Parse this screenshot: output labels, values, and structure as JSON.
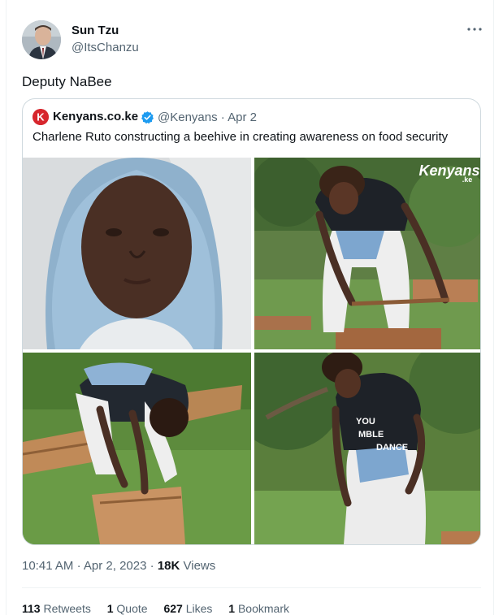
{
  "author": {
    "name": "Sun Tzu",
    "handle": "@ItsChanzu"
  },
  "tweet": {
    "text": "Deputy NaBee"
  },
  "quoted": {
    "name": "Kenyans.co.ke",
    "handle": "@Kenyans",
    "separator": "·",
    "date": "Apr 2",
    "text": "Charlene Ruto constructing a beehive in creating awareness on food security",
    "logo_letter": "K",
    "watermark": "Kenyans",
    "watermark_sub": ".ke",
    "shirt_text_1": "YOU",
    "shirt_text_2": "MBLE",
    "shirt_text_3": "DANCE"
  },
  "meta": {
    "time": "10:41 AM",
    "date": "Apr 2, 2023",
    "views_count": "18K",
    "views_label": "Views"
  },
  "stats": {
    "retweets_count": "113",
    "retweets_label": "Retweets",
    "quotes_count": "1",
    "quotes_label": "Quote",
    "likes_count": "627",
    "likes_label": "Likes",
    "bookmarks_count": "1",
    "bookmarks_label": "Bookmark"
  },
  "colors": {
    "verified_blue": "#1d9bf0",
    "kenyans_red": "#d7262d",
    "text_secondary": "#536471",
    "border": "#cfd9de"
  },
  "icons": {
    "more": "more-horizontal-icon",
    "verified": "verified-badge-icon",
    "logo": "kenyans-logo-icon"
  }
}
